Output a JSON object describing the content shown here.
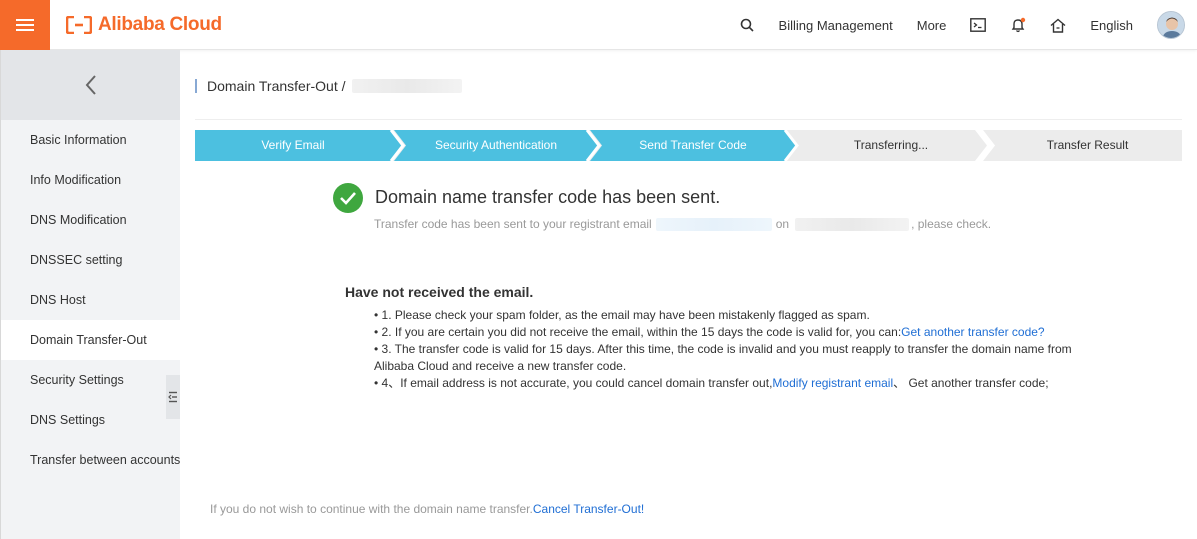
{
  "header": {
    "brand": "Alibaba Cloud",
    "nav": [
      "Billing Management",
      "More"
    ],
    "language": "English"
  },
  "sidebar": {
    "items": [
      {
        "label": "Basic Information"
      },
      {
        "label": "Info Modification"
      },
      {
        "label": "DNS Modification"
      },
      {
        "label": "DNSSEC setting"
      },
      {
        "label": "DNS Host"
      },
      {
        "label": "Domain Transfer-Out"
      },
      {
        "label": "Security Settings"
      },
      {
        "label": "DNS Settings"
      },
      {
        "label": "Transfer between accounts"
      }
    ],
    "active_index": 5
  },
  "page": {
    "title": "Domain Transfer-Out /"
  },
  "steps": [
    {
      "label": "Verify Email",
      "state": "done"
    },
    {
      "label": "Security Authentication",
      "state": "done"
    },
    {
      "label": "Send Transfer Code",
      "state": "current"
    },
    {
      "label": "Transferring...",
      "state": "pending"
    },
    {
      "label": "Transfer Result",
      "state": "pending"
    }
  ],
  "colors": {
    "accent": "#f56a2a",
    "step_active": "#4cc0e0",
    "step_pending": "#ececec",
    "success": "#3fa73f",
    "link": "#1f6ed4"
  },
  "result": {
    "title": "Domain name transfer code has been sent.",
    "sub_prefix": "Transfer code has been sent to your registrant email",
    "sub_on": "on",
    "sub_suffix": ", please check."
  },
  "help": {
    "title": "Have not received the email.",
    "item1": "• 1. Please check your spam folder, as the email may have been mistakenly flagged as spam.",
    "item2_text": "• 2. If you are certain you did not receive the email, within the 15 days the code is valid for, you can:",
    "item2_link": "Get another transfer code?",
    "item3": "• 3. The transfer code is valid for 15 days. After this time, the code is invalid and you must reapply to transfer the domain name from Alibaba Cloud and receive a new transfer code.",
    "item4_text": "• 4、If email address is not accurate, you could cancel domain transfer out,",
    "item4_link": "Modify registrant email",
    "item4_suffix": "、 Get another transfer code;"
  },
  "footer": {
    "text": "If you do not wish to continue with the domain name transfer.",
    "link": "Cancel Transfer-Out!"
  }
}
